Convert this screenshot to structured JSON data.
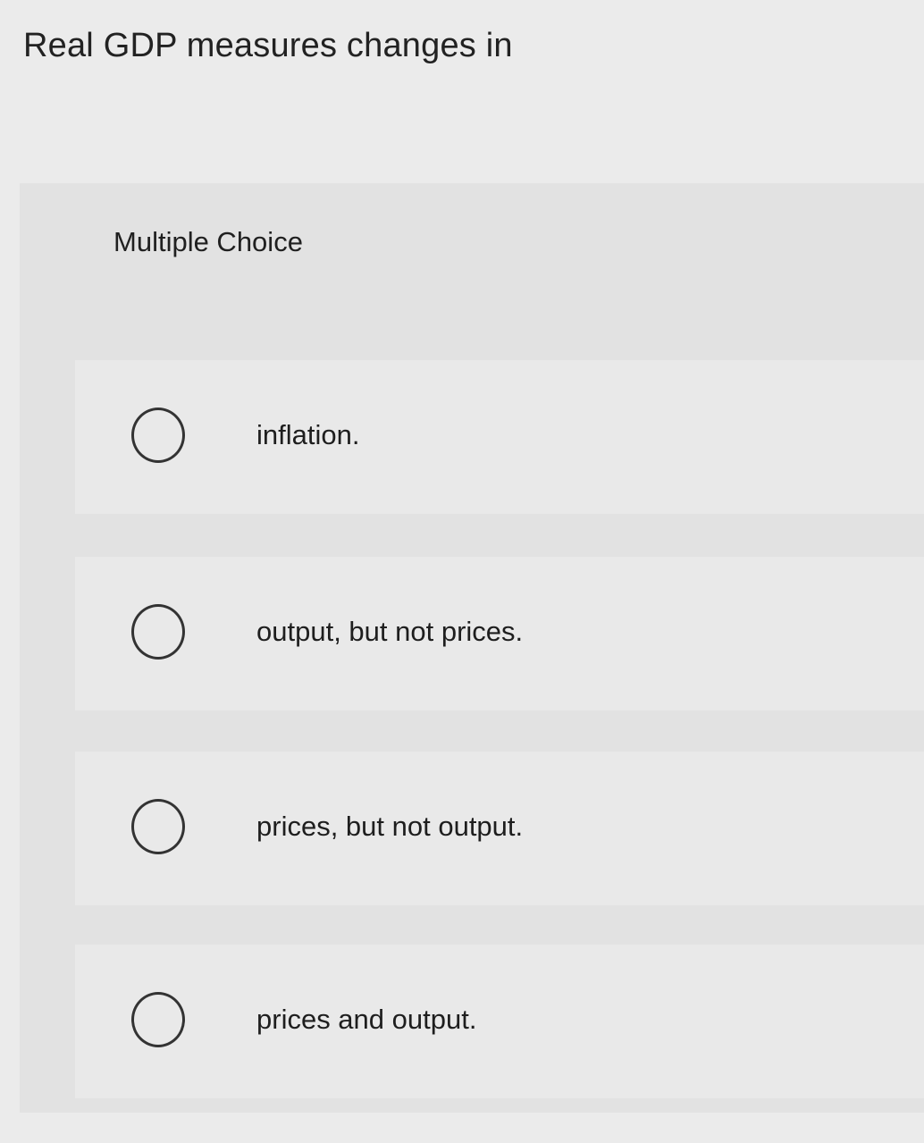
{
  "question": {
    "text": "Real GDP measures changes in"
  },
  "multiple_choice": {
    "label": "Multiple Choice",
    "options": [
      {
        "text": "inflation.",
        "selected": false
      },
      {
        "text": "output, but not prices.",
        "selected": false
      },
      {
        "text": "prices, but not output.",
        "selected": false
      },
      {
        "text": "prices and output.",
        "selected": false
      }
    ]
  },
  "colors": {
    "page_background": "#ebebeb",
    "panel_background": "#e2e2e2",
    "option_background": "#e9e9e9",
    "radio_border": "#333333",
    "text": "#1e1e1e"
  }
}
